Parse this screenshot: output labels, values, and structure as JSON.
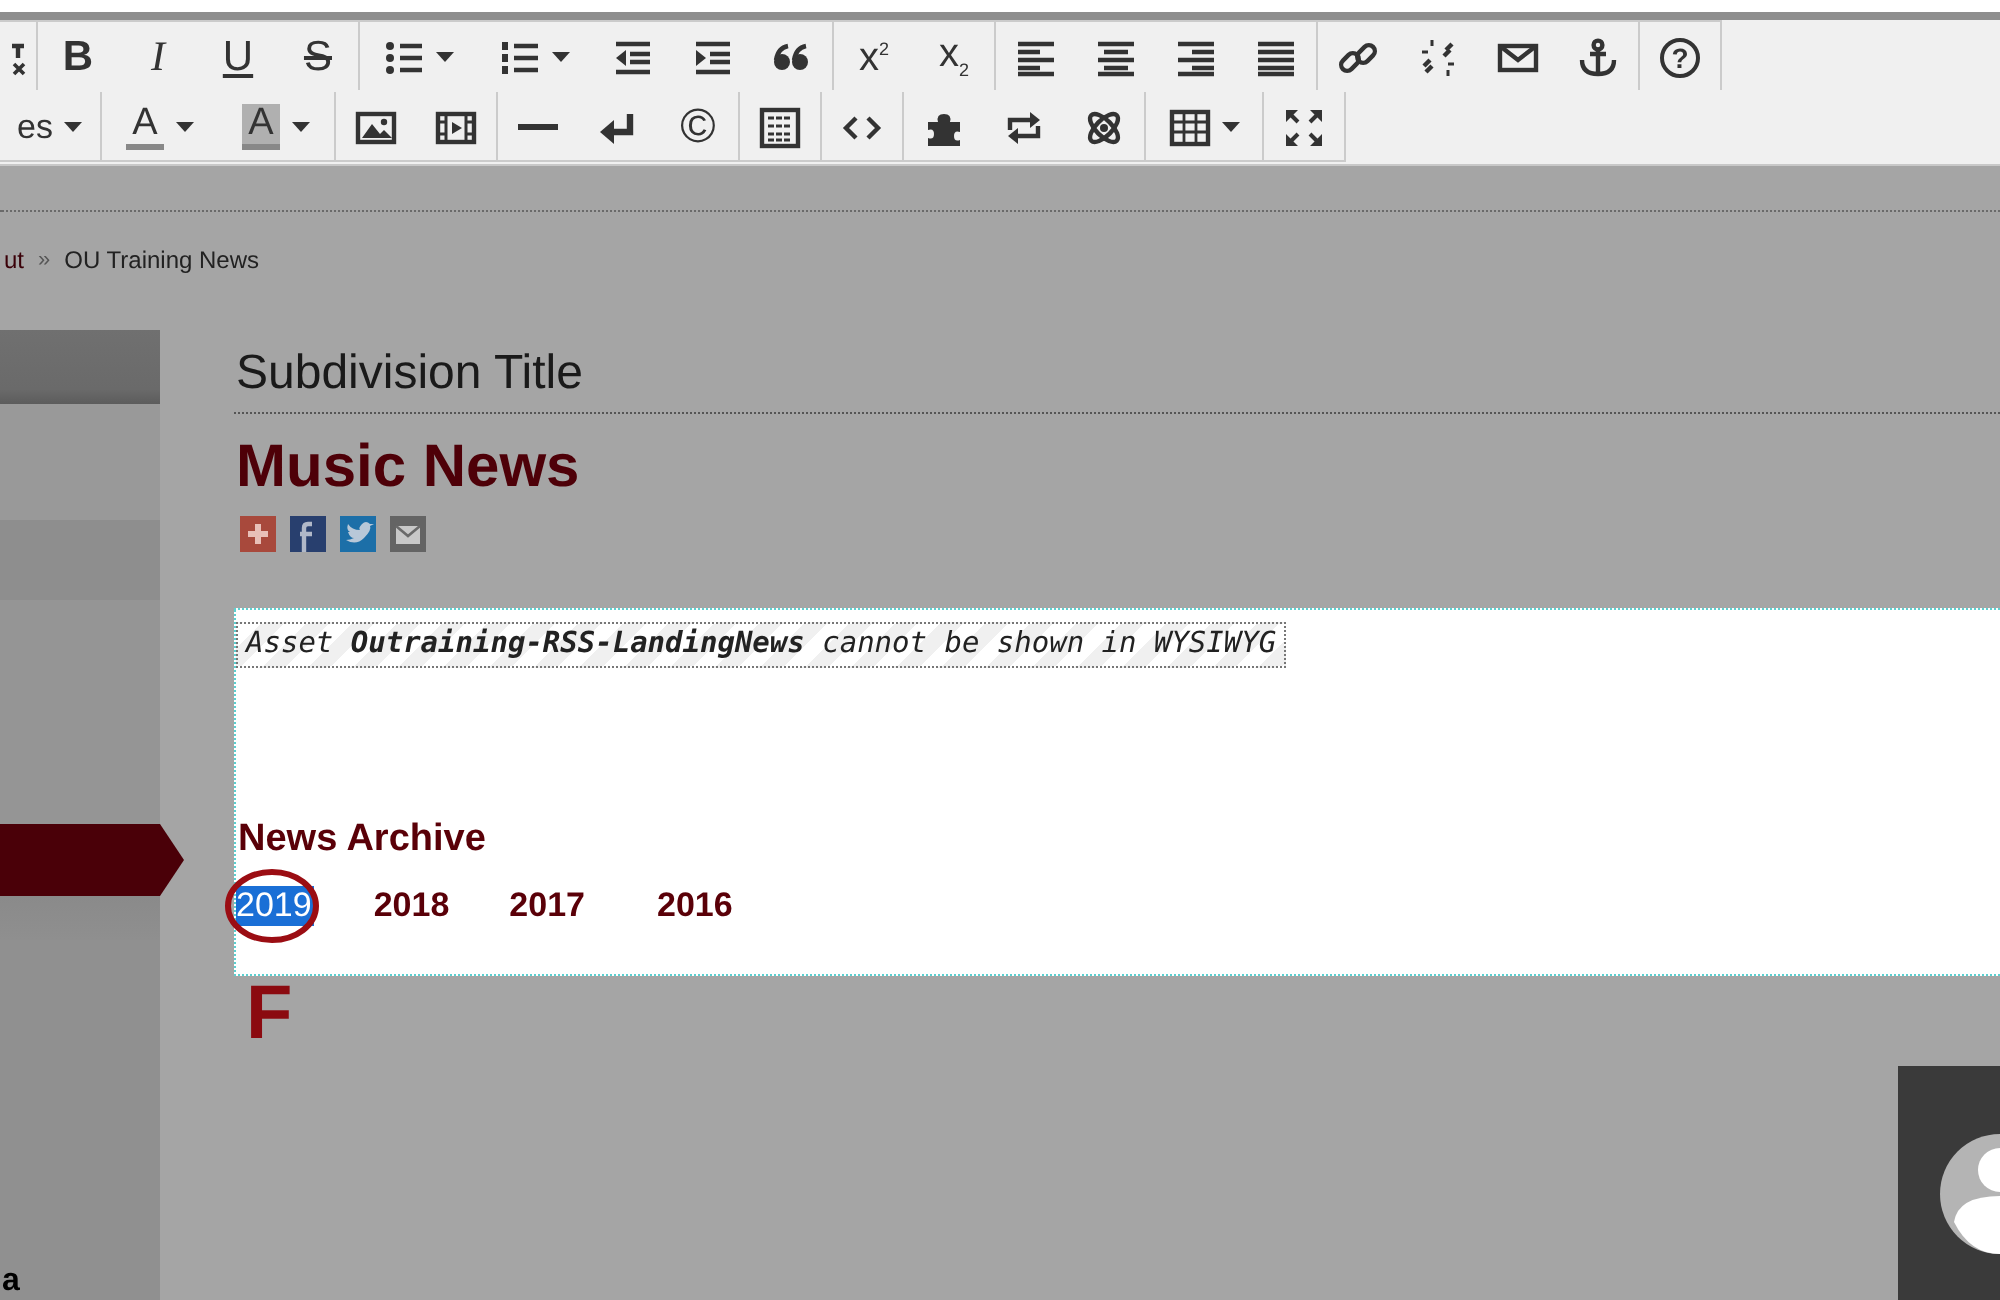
{
  "toolbar": {
    "rows": [
      [
        [
          {
            "kind": "icon"
          }
        ],
        [
          {
            "kind": "text",
            "label": "B"
          },
          {
            "kind": "text",
            "label": "I"
          },
          {
            "kind": "text",
            "label": "U"
          },
          {
            "kind": "text",
            "label": "S"
          }
        ],
        [
          {
            "kind": "icon",
            "dropdown": true
          },
          {
            "kind": "icon",
            "dropdown": true
          },
          {
            "kind": "icon"
          },
          {
            "kind": "icon"
          },
          {
            "kind": "icon"
          }
        ],
        [
          {
            "kind": "text",
            "label": "x$^{2}$"
          },
          {
            "kind": "text",
            "label": "x$_{2}$"
          }
        ],
        [
          {
            "kind": "icon"
          },
          {
            "kind": "icon"
          },
          {
            "kind": "icon"
          },
          {
            "kind": "icon"
          }
        ],
        [
          {
            "kind": "icon"
          },
          {
            "kind": "icon"
          },
          {
            "kind": "icon"
          },
          {
            "kind": "icon"
          }
        ],
        [
          {
            "kind": "text",
            "label": "?"
          }
        ]
      ],
      [
        [
          {
            "kind": "text",
            "label": "es",
            "dropdown": true
          }
        ],
        [
          {
            "kind": "color",
            "label": "A",
            "dropdown": true
          },
          {
            "kind": "color",
            "label": "A",
            "dropdown": true
          }
        ],
        [
          {
            "kind": "icon"
          },
          {
            "kind": "icon"
          }
        ],
        [
          {
            "kind": "icon"
          },
          {
            "kind": "icon"
          },
          {
            "kind": "text",
            "label": "©"
          }
        ],
        [
          {
            "kind": "icon"
          }
        ],
        [
          {
            "kind": "icon"
          }
        ],
        [
          {
            "kind": "icon"
          },
          {
            "kind": "icon"
          },
          {
            "kind": "icon"
          }
        ],
        [
          {
            "kind": "icon",
            "dropdown": true
          }
        ],
        [
          {
            "kind": "icon"
          }
        ]
      ]
    ]
  },
  "breadcrumb": [
    {
      "label": "ut",
      "kind": "link"
    },
    {
      "label": "»",
      "kind": "separator"
    },
    {
      "label": "OU Training News",
      "kind": "current"
    }
  ],
  "sidebar": {
    "items": [
      {
        "selected": false
      },
      {
        "selected": false
      },
      {
        "selected": false
      },
      {
        "selected": true
      },
      {
        "selected": false
      }
    ],
    "footer_text": "a"
  },
  "main": {
    "subdivision_title": "Subdivision Title",
    "page_title": "Music News",
    "asset_notice": "Asset **Outraining-RSS-LandingNews** cannot be shown in WYSIWYG",
    "archive_heading": "News Archive",
    "years": [
      {
        "label": "2019",
        "selected": true
      },
      {
        "label": "2018",
        "selected": false
      },
      {
        "label": "2017",
        "selected": false
      },
      {
        "label": "2016",
        "selected": false
      }
    ],
    "annotation_label": "F"
  }
}
